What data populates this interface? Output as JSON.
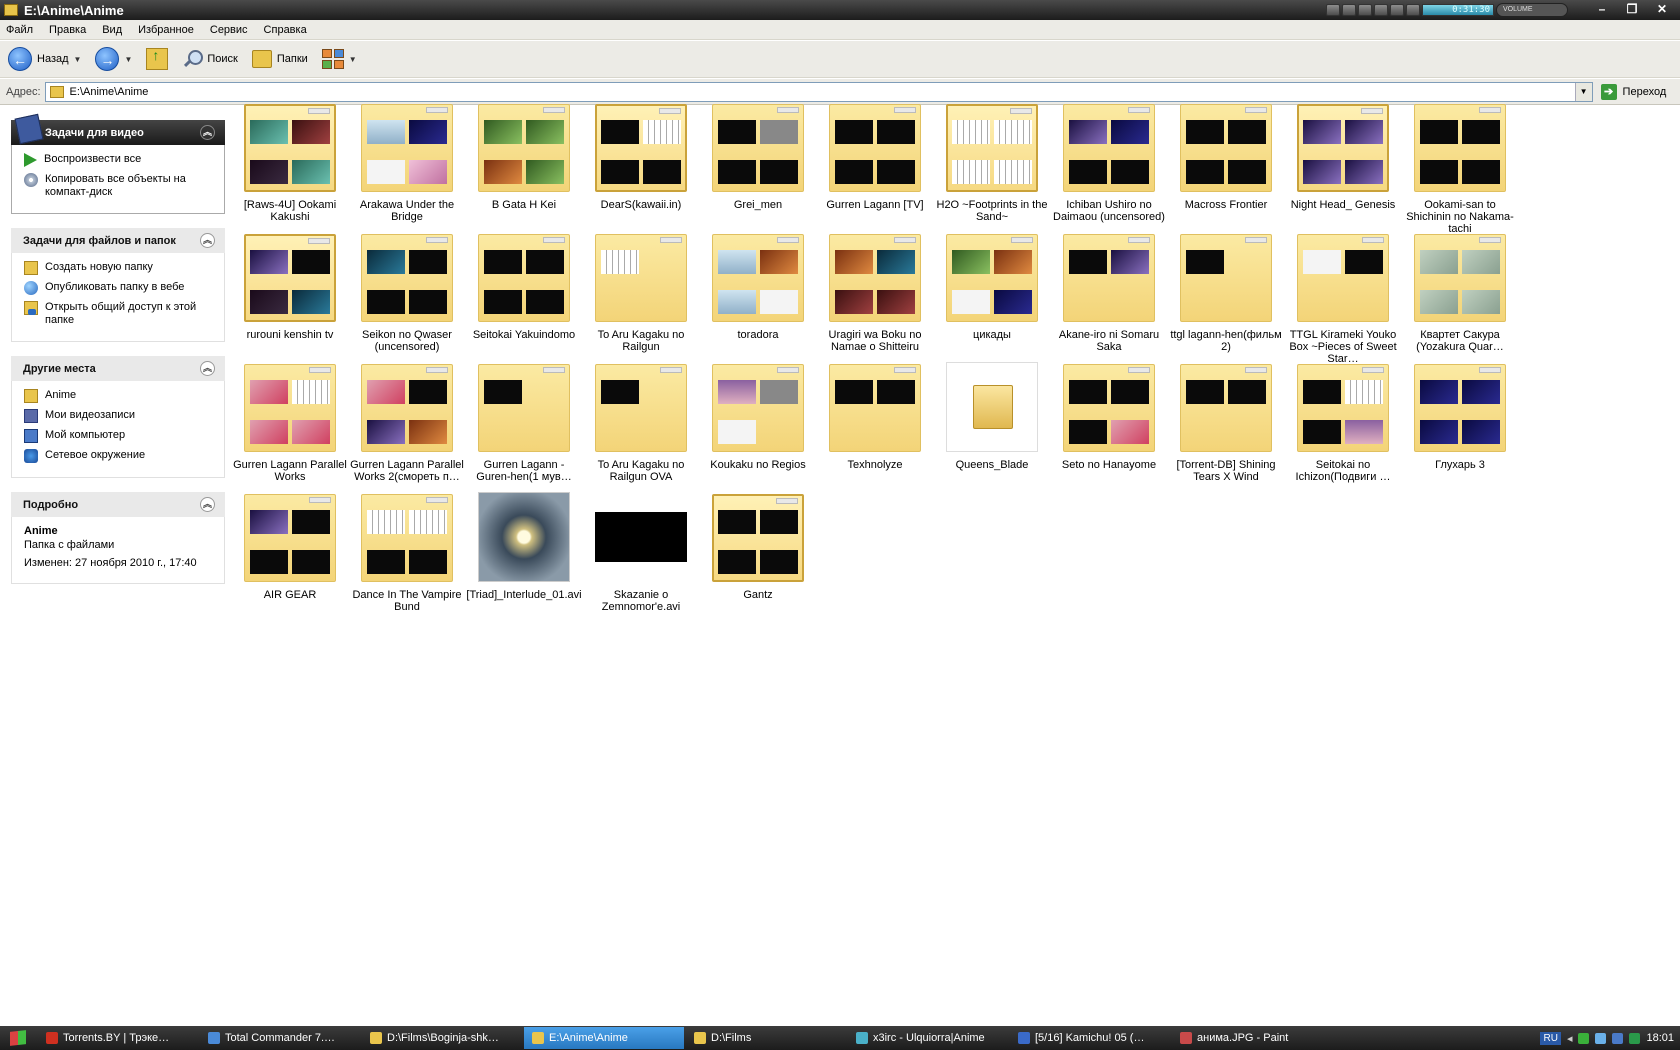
{
  "window": {
    "title": "E:\\Anime\\Anime",
    "player_time": "0:31:30",
    "volume_label": "VOLUME"
  },
  "menu": [
    "Файл",
    "Правка",
    "Вид",
    "Избранное",
    "Сервис",
    "Справка"
  ],
  "toolbar": {
    "back": "Назад",
    "search": "Поиск",
    "folders": "Папки"
  },
  "address": {
    "label": "Адрес:",
    "value": "E:\\Anime\\Anime",
    "go": "Переход"
  },
  "panels": {
    "video": {
      "title": "Задачи для видео",
      "items": [
        "Воспроизвести все",
        "Копировать все объекты на компакт-диск"
      ]
    },
    "files": {
      "title": "Задачи для файлов и папок",
      "items": [
        "Создать новую папку",
        "Опубликовать папку в вебе",
        "Открыть общий доступ к этой папке"
      ]
    },
    "places": {
      "title": "Другие места",
      "items": [
        "Anime",
        "Мои видеозаписи",
        "Мой компьютер",
        "Сетевое окружение"
      ]
    },
    "details": {
      "title": "Подробно",
      "name": "Anime",
      "type": "Папка с файлами",
      "modified": "Изменен: 27 ноября 2010 г., 17:40"
    }
  },
  "items": [
    {
      "name": "[Raws-4U] Ookami Kakushi",
      "kind": "folder-open",
      "minis": [
        "c-land",
        "c-red",
        "c-dark",
        "c-land"
      ]
    },
    {
      "name": "Arakawa Under the Bridge",
      "kind": "folder",
      "minis": [
        "c-sky",
        "c-blue",
        "c-white",
        "c-pink"
      ]
    },
    {
      "name": "B Gata H Kei",
      "kind": "folder",
      "minis": [
        "c-green",
        "c-green",
        "c-orange",
        "c-green"
      ]
    },
    {
      "name": "DearS(kawaii.in)",
      "kind": "folder-open",
      "minis": [
        "",
        "c-manga",
        "",
        ""
      ]
    },
    {
      "name": "Grei_men",
      "kind": "folder",
      "minis": [
        "",
        "c-grey",
        "",
        ""
      ]
    },
    {
      "name": "Gurren Lagann [TV]",
      "kind": "folder",
      "minis": [
        "",
        "",
        "",
        ""
      ]
    },
    {
      "name": "H2O ~Footprints in the Sand~",
      "kind": "folder-open",
      "minis": [
        "c-manga",
        "c-manga",
        "c-manga",
        "c-manga"
      ]
    },
    {
      "name": "Ichiban Ushiro no Daimaou (uncensored)",
      "kind": "folder",
      "minis": [
        "c-purple",
        "c-blue",
        "",
        ""
      ]
    },
    {
      "name": "Macross Frontier",
      "kind": "folder",
      "minis": [
        "",
        "",
        "",
        ""
      ]
    },
    {
      "name": "Night Head_ Genesis",
      "kind": "folder-open",
      "minis": [
        "c-purple",
        "c-purple",
        "c-purple",
        "c-purple"
      ]
    },
    {
      "name": "Ookami-san to Shichinin no Nakama-tachi",
      "kind": "folder",
      "minis": [
        "",
        "",
        "",
        ""
      ]
    },
    {
      "name": "rurouni kenshin tv",
      "kind": "folder-open",
      "minis": [
        "c-purple",
        "",
        "c-dark",
        "c-teal"
      ]
    },
    {
      "name": "Seikon no Qwaser (uncensored)",
      "kind": "folder",
      "minis": [
        "c-teal",
        "",
        "",
        ""
      ]
    },
    {
      "name": "Seitokai Yakuindomo",
      "kind": "folder",
      "minis": [
        "",
        "",
        "",
        ""
      ]
    },
    {
      "name": "To Aru Kagaku no Railgun",
      "kind": "folder",
      "minis": [
        "c-manga",
        "none",
        "none",
        "none"
      ]
    },
    {
      "name": "toradora",
      "kind": "folder",
      "minis": [
        "c-sky",
        "c-orange",
        "c-sky",
        "c-white"
      ]
    },
    {
      "name": "Uragiri wa Boku no Namae o Shitteiru",
      "kind": "folder",
      "minis": [
        "c-orange",
        "c-teal",
        "c-red",
        "c-red"
      ]
    },
    {
      "name": "цикады",
      "kind": "folder",
      "minis": [
        "c-green",
        "c-orange",
        "c-white",
        "c-blue"
      ]
    },
    {
      "name": "Akane-iro ni Somaru Saka",
      "kind": "folder",
      "minis": [
        "",
        "c-purple",
        "none",
        "none"
      ]
    },
    {
      "name": "ttgl lagann-hen(фильм 2)",
      "kind": "folder",
      "minis": [
        "",
        "none",
        "none",
        "none"
      ]
    },
    {
      "name": "TTGL Kirameki Youko Box ~Pieces of Sweet Star…",
      "kind": "folder",
      "minis": [
        "c-white",
        "",
        "none",
        "none"
      ]
    },
    {
      "name": "Квартет Сакура (Yozakura Quar…",
      "kind": "folder",
      "minis": [
        "c-pale",
        "c-pale",
        "c-pale",
        "c-pale"
      ]
    },
    {
      "name": "Gurren Lagann Parallel Works",
      "kind": "folder",
      "minis": [
        "c-pinkred",
        "c-manga",
        "c-pinkred",
        "c-pinkred"
      ]
    },
    {
      "name": "Gurren Lagann Parallel Works 2(смореть п…",
      "kind": "folder",
      "minis": [
        "c-pinkred",
        "",
        "c-purple",
        "c-orange"
      ]
    },
    {
      "name": "Gurren Lagann - Guren-hen(1 мув…",
      "kind": "folder",
      "minis": [
        "",
        "none",
        "none",
        "none"
      ]
    },
    {
      "name": "To Aru Kagaku no Railgun OVA",
      "kind": "folder",
      "minis": [
        "",
        "none",
        "none",
        "none"
      ]
    },
    {
      "name": "Koukaku no Regios",
      "kind": "folder",
      "minis": [
        "c-sunset",
        "c-grey",
        "c-white",
        "none"
      ]
    },
    {
      "name": "Texhnolyze",
      "kind": "folder",
      "minis": [
        "",
        "",
        "none",
        "none"
      ]
    },
    {
      "name": "Queens_Blade",
      "kind": "plain",
      "minis": []
    },
    {
      "name": "Seto no Hanayome",
      "kind": "folder",
      "minis": [
        "",
        "",
        "",
        "c-pinkred"
      ]
    },
    {
      "name": "[Torrent-DB] Shining Tears X Wind",
      "kind": "folder",
      "minis": [
        "",
        "",
        "none",
        "none"
      ]
    },
    {
      "name": "Seitokai no Ichizon(Подвиги …",
      "kind": "folder",
      "minis": [
        "",
        "c-manga",
        "",
        "c-sunset"
      ]
    },
    {
      "name": "Глухарь 3",
      "kind": "folder",
      "minis": [
        "c-blue",
        "c-blue",
        "c-blue",
        "c-blue"
      ]
    },
    {
      "name": "AIR GEAR",
      "kind": "folder",
      "minis": [
        "c-purple",
        "",
        "",
        ""
      ]
    },
    {
      "name": "Dance In The Vampire Bund",
      "kind": "folder",
      "minis": [
        "c-manga",
        "c-manga",
        "",
        ""
      ]
    },
    {
      "name": "[Triad]_Interlude_01.avi",
      "kind": "video",
      "minis": []
    },
    {
      "name": "Skazanie o Zemnomor'e.avi",
      "kind": "black",
      "minis": []
    },
    {
      "name": "Gantz",
      "kind": "folder-open",
      "minis": [
        "",
        "",
        "",
        ""
      ]
    }
  ],
  "taskbar": {
    "buttons": [
      {
        "label": "Torrents.BY | Трэке…",
        "color": "#d03020",
        "active": false
      },
      {
        "label": "Total Commander 7.…",
        "color": "#4a8ad8",
        "active": false
      },
      {
        "label": "D:\\Films\\Boginja-shk…",
        "color": "#e9c54c",
        "active": false
      },
      {
        "label": "E:\\Anime\\Anime",
        "color": "#e9c54c",
        "active": true
      },
      {
        "label": "D:\\Films",
        "color": "#e9c54c",
        "active": false
      },
      {
        "label": "x3irc - Ulquiorra|Anime",
        "color": "#4ab0c8",
        "active": false
      },
      {
        "label": "[5/16] Kamichu! 05 (…",
        "color": "#3a6ac8",
        "active": false
      },
      {
        "label": "анима.JPG - Paint",
        "color": "#c84a4a",
        "active": false
      }
    ],
    "lang": "RU",
    "clock": "18:01"
  }
}
